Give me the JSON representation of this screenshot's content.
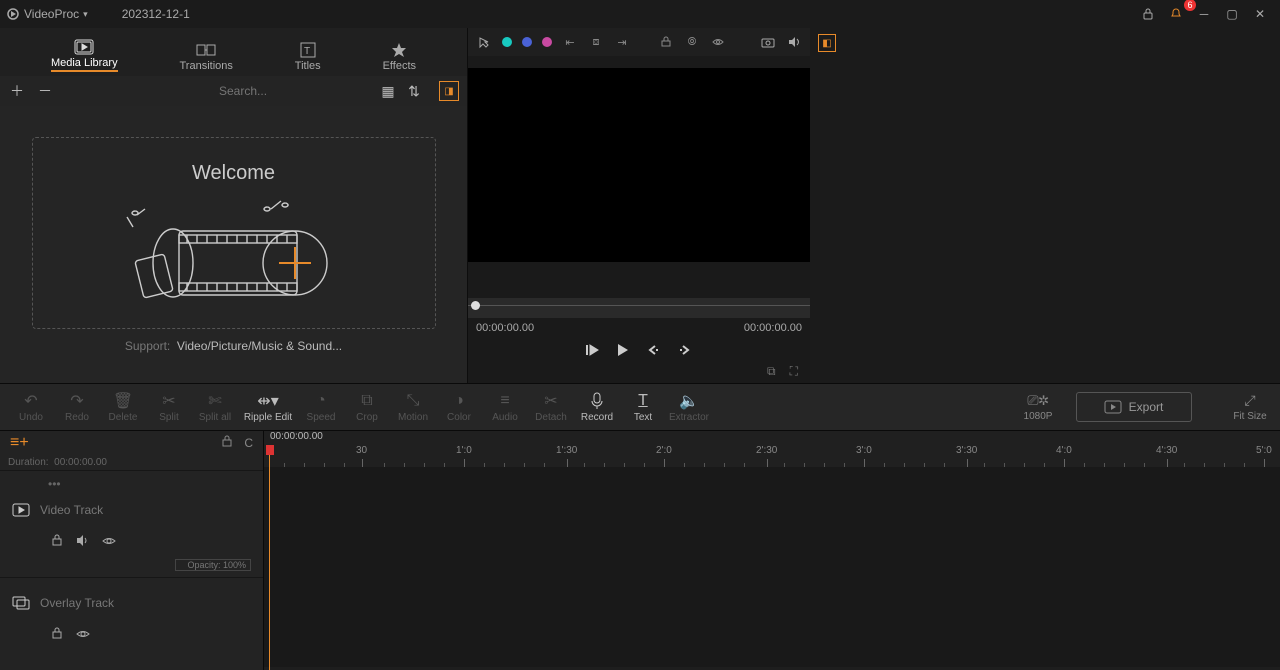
{
  "title_app": "VideoProc",
  "title_project": "202312-12-1",
  "notif_count": "6",
  "tabs": {
    "media": "Media Library",
    "trans": "Transitions",
    "titles": "Titles",
    "effects": "Effects"
  },
  "search_placeholder": "Search...",
  "welcome": "Welcome",
  "support_label": "Support:",
  "support_text": "Video/Picture/Music & Sound...",
  "preview": {
    "time_l": "00:00:00.00",
    "time_r": "00:00:00.00"
  },
  "tools": {
    "undo": "Undo",
    "redo": "Redo",
    "delete": "Delete",
    "split": "Split",
    "splitall": "Split all",
    "ripple": "Ripple Edit",
    "speed": "Speed",
    "crop": "Crop",
    "motion": "Motion",
    "color": "Color",
    "audio": "Audio",
    "detach": "Detach",
    "record": "Record",
    "text": "Text",
    "extractor": "Extractor",
    "resolution": "1080P",
    "export": "Export",
    "fitsize": "Fit Size"
  },
  "timeline": {
    "timecode": "00:00:00.00",
    "duration_label": "Duration:",
    "duration_value": "00:00:00.00",
    "ticks": [
      "30",
      "1':0",
      "1':30",
      "2':0",
      "2':30",
      "3':0",
      "3':30",
      "4':0",
      "4':30",
      "5':0"
    ],
    "video_track": "Video Track",
    "overlay_track": "Overlay Track",
    "opacity": "Opacity: 100%"
  }
}
